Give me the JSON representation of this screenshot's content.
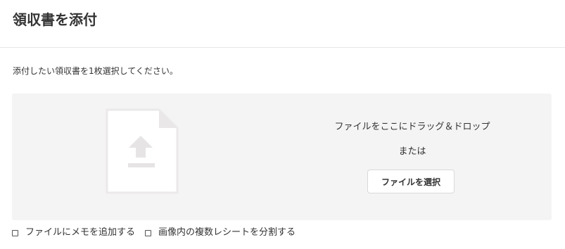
{
  "header": {
    "title": "領収書を添付"
  },
  "instruction": "添付したい領収書を1枚選択してください。",
  "dropzone": {
    "icon": "file-upload-icon",
    "drop_text": "ファイルをここにドラッグ＆ドロップ",
    "or_text": "または",
    "select_button_label": "ファイルを選択"
  },
  "options": [
    {
      "label": "ファイルにメモを追加する",
      "checked": false
    },
    {
      "label": "画像内の複数レシートを分割する",
      "checked": false
    }
  ],
  "colors": {
    "dropzone_bg": "#f5f4f4",
    "icon_fill": "#ffffff",
    "icon_fold": "#e9e7e7",
    "icon_arrow": "#e6e4e4",
    "text": "#333333"
  }
}
